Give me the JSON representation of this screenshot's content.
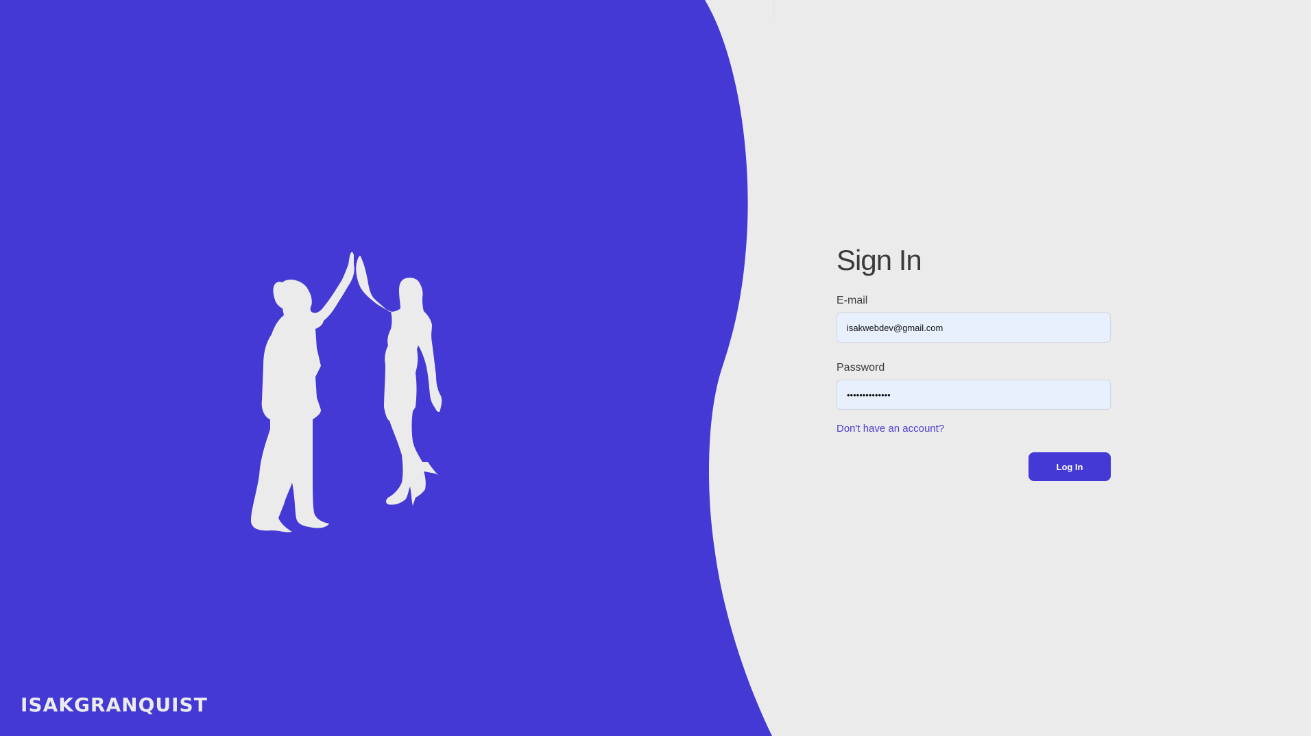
{
  "brand": {
    "name": "ISAKGRANQUIST"
  },
  "theme": {
    "accent": "#4439d4",
    "background": "#ebebeb",
    "text": "#3b3b3b",
    "link": "#4b3fcf"
  },
  "hero": {
    "illustration_icon": "high-five-silhouette-icon"
  },
  "signin": {
    "title": "Sign In",
    "email_label": "E-mail",
    "email_value": "isakwebdev@gmail.com",
    "password_label": "Password",
    "password_value": "••••••••••••••",
    "signup_link": "Don't have an account?",
    "submit_label": "Log In"
  }
}
